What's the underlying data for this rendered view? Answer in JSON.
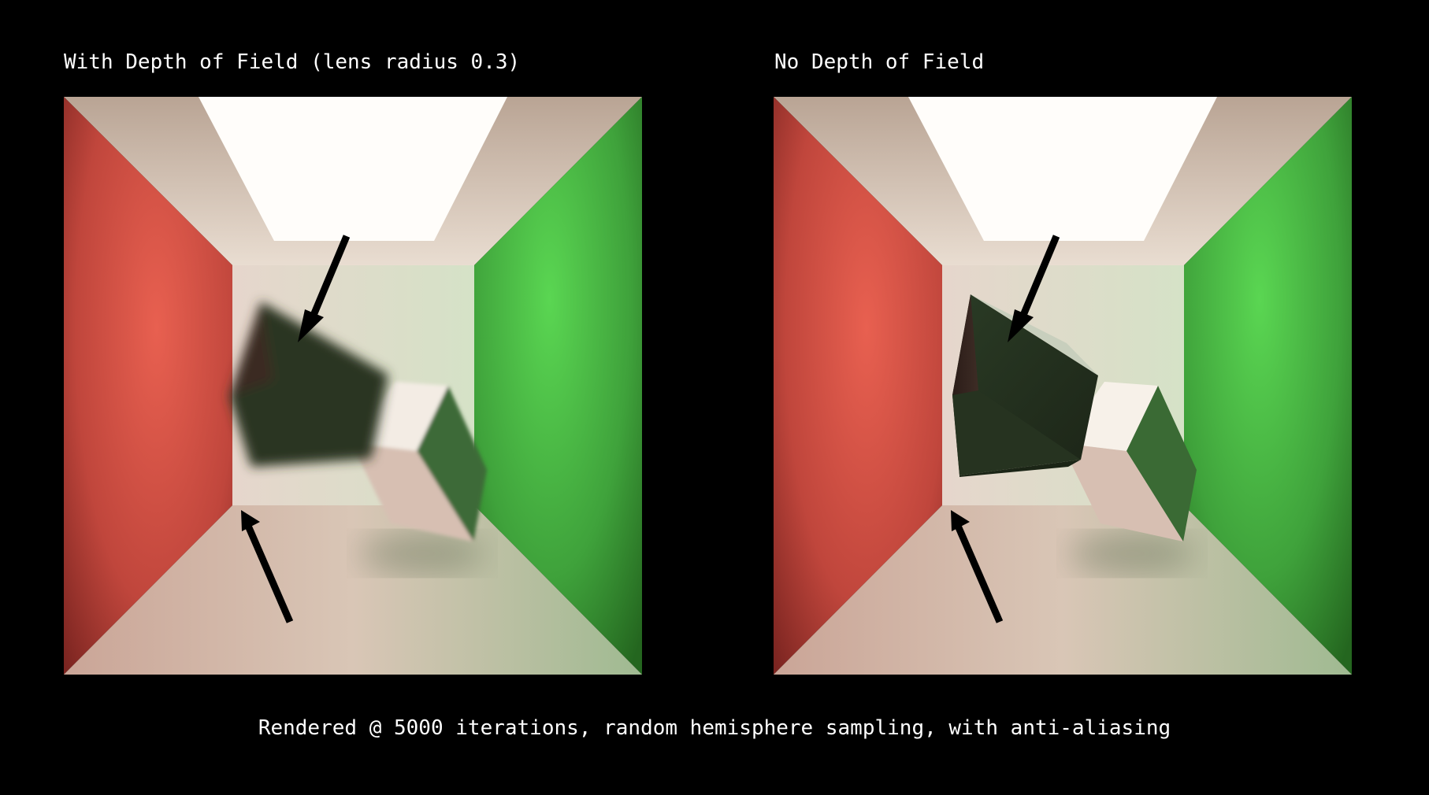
{
  "left_panel": {
    "title": "With Depth of Field (lens radius 0.3)"
  },
  "right_panel": {
    "title": "No Depth of Field"
  },
  "caption": "Rendered @ 5000 iterations, random hemisphere sampling, with anti-aliasing",
  "colors": {
    "background": "#000000",
    "red_wall": "#c0463c",
    "green_wall": "#3fa23b",
    "light": "#ffffff",
    "arrow": "#000000"
  }
}
